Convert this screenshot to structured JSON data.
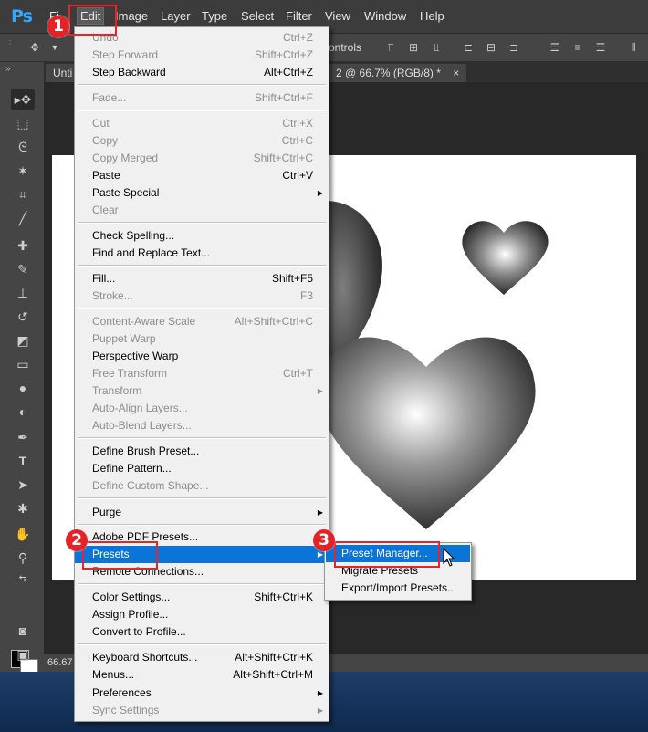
{
  "app": {
    "logo": "Ps"
  },
  "menubar": {
    "items": [
      {
        "label": "Fi"
      },
      {
        "label": "Edit"
      },
      {
        "label": "Image"
      },
      {
        "label": "Layer"
      },
      {
        "label": "Type"
      },
      {
        "label": "Select"
      },
      {
        "label": "Filter"
      },
      {
        "label": "View"
      },
      {
        "label": "Window"
      },
      {
        "label": "Help"
      }
    ]
  },
  "options_bar": {
    "show_transform_controls_label": "ontrols"
  },
  "tabs": [
    {
      "label": "Unti"
    },
    {
      "label": "2 @ 66.7% (RGB/8) *",
      "close": "×"
    }
  ],
  "status": {
    "zoom": "66.67"
  },
  "edit_menu": {
    "items": [
      {
        "label": "Undo",
        "shortcut": "Ctrl+Z",
        "disabled": true
      },
      {
        "label": "Step Forward",
        "shortcut": "Shift+Ctrl+Z",
        "disabled": true
      },
      {
        "label": "Step Backward",
        "shortcut": "Alt+Ctrl+Z",
        "disabled": false
      },
      {
        "label": "Fade...",
        "shortcut": "Shift+Ctrl+F",
        "disabled": true
      },
      {
        "label": "Cut",
        "shortcut": "Ctrl+X",
        "disabled": true
      },
      {
        "label": "Copy",
        "shortcut": "Ctrl+C",
        "disabled": true
      },
      {
        "label": "Copy Merged",
        "shortcut": "Shift+Ctrl+C",
        "disabled": true
      },
      {
        "label": "Paste",
        "shortcut": "Ctrl+V",
        "disabled": false
      },
      {
        "label": "Paste Special",
        "shortcut": "",
        "disabled": false,
        "submenu": true
      },
      {
        "label": "Clear",
        "shortcut": "",
        "disabled": true
      },
      {
        "label": "Check Spelling...",
        "shortcut": "",
        "disabled": false
      },
      {
        "label": "Find and Replace Text...",
        "shortcut": "",
        "disabled": false
      },
      {
        "label": "Fill...",
        "shortcut": "Shift+F5",
        "disabled": false
      },
      {
        "label": "Stroke...",
        "shortcut": "F3",
        "disabled": true
      },
      {
        "label": "Content-Aware Scale",
        "shortcut": "Alt+Shift+Ctrl+C",
        "disabled": true
      },
      {
        "label": "Puppet Warp",
        "shortcut": "",
        "disabled": true
      },
      {
        "label": "Perspective Warp",
        "shortcut": "",
        "disabled": false
      },
      {
        "label": "Free Transform",
        "shortcut": "Ctrl+T",
        "disabled": true
      },
      {
        "label": "Transform",
        "shortcut": "",
        "disabled": true,
        "submenu": true
      },
      {
        "label": "Auto-Align Layers...",
        "shortcut": "",
        "disabled": true
      },
      {
        "label": "Auto-Blend Layers...",
        "shortcut": "",
        "disabled": true
      },
      {
        "label": "Define Brush Preset...",
        "shortcut": "",
        "disabled": false
      },
      {
        "label": "Define Pattern...",
        "shortcut": "",
        "disabled": false
      },
      {
        "label": "Define Custom Shape...",
        "shortcut": "",
        "disabled": true
      },
      {
        "label": "Purge",
        "shortcut": "",
        "disabled": false,
        "submenu": true
      },
      {
        "label": "Adobe PDF Presets...",
        "shortcut": "",
        "disabled": false
      },
      {
        "label": "Presets",
        "shortcut": "",
        "disabled": false,
        "submenu": true,
        "highlighted": true
      },
      {
        "label": "Remote Connections...",
        "shortcut": "",
        "disabled": false
      },
      {
        "label": "Color Settings...",
        "shortcut": "Shift+Ctrl+K",
        "disabled": false
      },
      {
        "label": "Assign Profile...",
        "shortcut": "",
        "disabled": false
      },
      {
        "label": "Convert to Profile...",
        "shortcut": "",
        "disabled": false
      },
      {
        "label": "Keyboard Shortcuts...",
        "shortcut": "Alt+Shift+Ctrl+K",
        "disabled": false
      },
      {
        "label": "Menus...",
        "shortcut": "Alt+Shift+Ctrl+M",
        "disabled": false
      },
      {
        "label": "Preferences",
        "shortcut": "",
        "disabled": false,
        "submenu": true
      },
      {
        "label": "Sync Settings",
        "shortcut": "",
        "disabled": true,
        "submenu": true
      }
    ]
  },
  "presets_submenu": {
    "items": [
      {
        "label": "Preset Manager...",
        "highlighted": true
      },
      {
        "label": "Migrate Presets",
        "highlighted": false
      },
      {
        "label": "Export/Import Presets...",
        "highlighted": false
      }
    ]
  },
  "callouts": [
    {
      "number": "1"
    },
    {
      "number": "2"
    },
    {
      "number": "3"
    }
  ],
  "colors": {
    "highlight": "#0a74d8",
    "callout": "#e42328",
    "brand": "#31a8ff"
  }
}
